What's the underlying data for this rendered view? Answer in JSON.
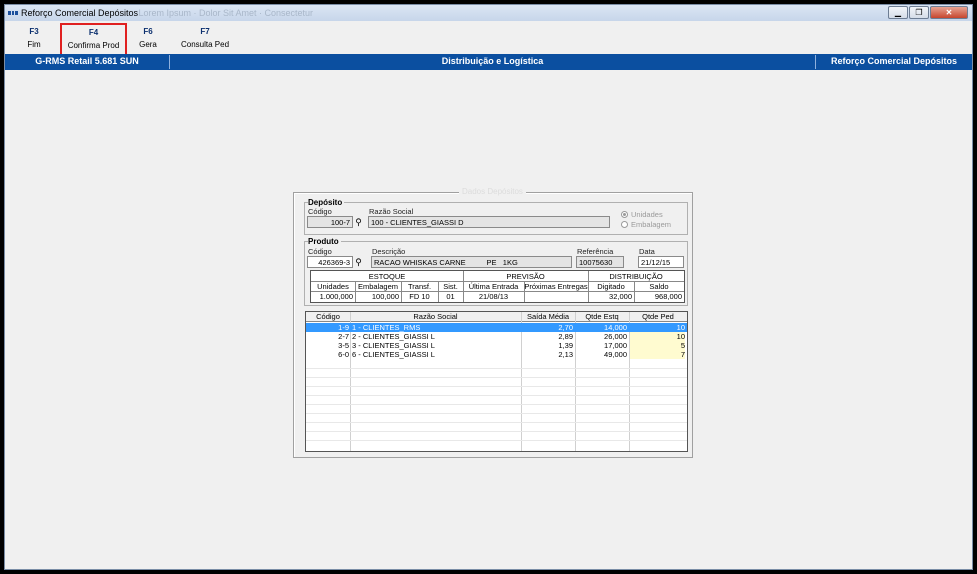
{
  "window": {
    "title": "Reforço Comercial Depósitos",
    "title_ghost": "· Lorem Ipsum · Dolor Sit Amet · Consectetur"
  },
  "toolbar": [
    {
      "key": "F3",
      "label": "Fim"
    },
    {
      "key": "F4",
      "label": "Confirma Prod"
    },
    {
      "key": "F6",
      "label": "Gera"
    },
    {
      "key": "F7",
      "label": "Consulta Ped"
    }
  ],
  "header": {
    "system": "G-RMS Retail 5.681 SUN",
    "module": "Distribuição e Logística",
    "screen": "Reforço Comercial Depósitos"
  },
  "panel": {
    "title": "Dados Depósitos"
  },
  "deposito": {
    "legend": "Depósito",
    "codigo_label": "Código",
    "codigo": "100-7",
    "razao_label": "Razão Social",
    "razao": "100 - CLIENTES_GIASSI D",
    "opt_unidades": "Unidades",
    "opt_embalagem": "Embalagem"
  },
  "produto": {
    "legend": "Produto",
    "codigo_label": "Código",
    "codigo": "426369-3",
    "descricao_label": "Descrição",
    "descricao": "RACAO WHISKAS CARNE          PE   1KG",
    "referencia_label": "Referência",
    "referencia": "10075630",
    "data_label": "Data",
    "data": "21/12/15"
  },
  "stock": {
    "estoque": "ESTOQUE",
    "previsao": "PREVISÃO",
    "distribuicao": "DISTRIBUIÇÃO",
    "cols": [
      "Unidades",
      "Embalagem",
      "Transf.",
      "Sist.",
      "Última Entrada",
      "Próximas Entregas",
      "Digitado",
      "Saldo"
    ],
    "values": [
      "1.000,000",
      "100,000",
      "FD 10",
      "01",
      "21/08/13",
      "",
      "32,000",
      "968,000"
    ]
  },
  "grid": {
    "cols": [
      "Código",
      "Razão Social",
      "Saída Média",
      "Qtde Estq",
      "Qtde Ped"
    ],
    "rows": [
      {
        "codigo": "1-9",
        "razao": "1 - CLIENTES_RMS",
        "saida": "2,70",
        "estq": "14,000",
        "ped": "10"
      },
      {
        "codigo": "2-7",
        "razao": "2 - CLIENTES_GIASSI L",
        "saida": "2,89",
        "estq": "26,000",
        "ped": "10"
      },
      {
        "codigo": "3-5",
        "razao": "3 - CLIENTES_GIASSI L",
        "saida": "1,39",
        "estq": "17,000",
        "ped": "5"
      },
      {
        "codigo": "6-0",
        "razao": "6 - CLIENTES_GIASSI L",
        "saida": "2,13",
        "estq": "49,000",
        "ped": "7"
      }
    ]
  },
  "colors": {
    "header_bar": "#0b4fa0",
    "selection": "#3399ff",
    "highlight": "#e02020"
  }
}
